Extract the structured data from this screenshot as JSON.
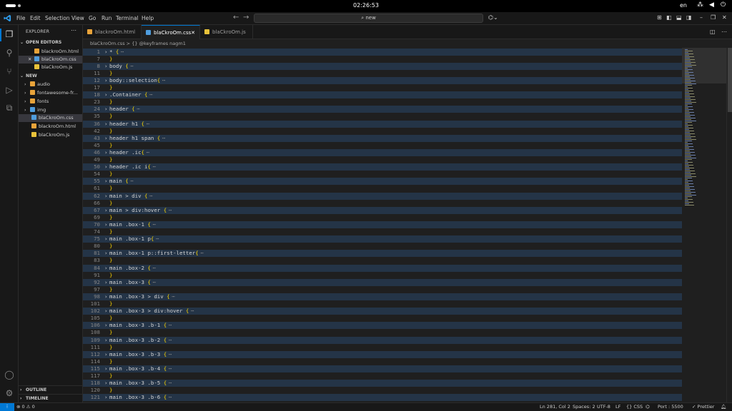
{
  "os": {
    "clock": "02:26:53",
    "lang": "en"
  },
  "menu": [
    "File",
    "Edit",
    "Selection",
    "View",
    "Go",
    "Run",
    "Terminal",
    "Help"
  ],
  "search": {
    "value": "new"
  },
  "sidebar": {
    "title": "EXPLORER",
    "open_editors_label": "OPEN EDITORS",
    "open_editors": [
      {
        "name": "blackroOm.html",
        "type": "html",
        "selected": false
      },
      {
        "name": "blaCkroOm.css",
        "type": "css",
        "selected": true
      },
      {
        "name": "blaCkroOm.js",
        "type": "js",
        "selected": false
      }
    ],
    "folder_label": "NEW",
    "tree": [
      {
        "name": "audio",
        "kind": "folder",
        "color": "#e8a33a"
      },
      {
        "name": "fontawesome-fr...",
        "kind": "folder",
        "color": "#e8a33a"
      },
      {
        "name": "fonts",
        "kind": "folder",
        "color": "#e8a33a"
      },
      {
        "name": "img",
        "kind": "folder",
        "color": "#4f9dde"
      },
      {
        "name": "blaCkroOm.css",
        "kind": "css",
        "selected": true
      },
      {
        "name": "blackroOm.html",
        "kind": "html"
      },
      {
        "name": "blaCkroOm.js",
        "kind": "js"
      }
    ],
    "outline_label": "OUTLINE",
    "timeline_label": "TIMELINE"
  },
  "tabs": [
    {
      "label": "blackroOm.html",
      "type": "html",
      "active": false
    },
    {
      "label": "blaCkroOm.css",
      "type": "css",
      "active": true
    },
    {
      "label": "blaCkroOm.js",
      "type": "js",
      "active": false
    }
  ],
  "breadcrumb": {
    "file": "blaCkroOm.css",
    "sep": ">",
    "symbol": "@keyframes nagm1"
  },
  "code_lines": [
    {
      "n": "1",
      "text": "* {",
      "fold": true
    },
    {
      "n": "7",
      "text": "}",
      "fold": false
    },
    {
      "n": "8",
      "text": "body {",
      "fold": true
    },
    {
      "n": "11",
      "text": "}",
      "fold": false
    },
    {
      "n": "12",
      "text": "body::selection{",
      "fold": true
    },
    {
      "n": "17",
      "text": "}",
      "fold": false
    },
    {
      "n": "18",
      "text": ".Container {",
      "fold": true
    },
    {
      "n": "23",
      "text": "}",
      "fold": false
    },
    {
      "n": "24",
      "text": "header {",
      "fold": true
    },
    {
      "n": "35",
      "text": "}",
      "fold": false
    },
    {
      "n": "36",
      "text": "header h1 {",
      "fold": true
    },
    {
      "n": "42",
      "text": "}",
      "fold": false
    },
    {
      "n": "43",
      "text": "header h1 span {",
      "fold": true
    },
    {
      "n": "45",
      "text": "}",
      "fold": false
    },
    {
      "n": "46",
      "text": "header .ic{",
      "fold": true
    },
    {
      "n": "49",
      "text": "}",
      "fold": false
    },
    {
      "n": "50",
      "text": "header .ic i{",
      "fold": true
    },
    {
      "n": "54",
      "text": "}",
      "fold": false
    },
    {
      "n": "55",
      "text": "main {",
      "fold": true
    },
    {
      "n": "61",
      "text": "}",
      "fold": false
    },
    {
      "n": "62",
      "text": "main > div {",
      "fold": true
    },
    {
      "n": "66",
      "text": "}",
      "fold": false
    },
    {
      "n": "67",
      "text": "main > div:hover {",
      "fold": true
    },
    {
      "n": "69",
      "text": "}",
      "fold": false
    },
    {
      "n": "70",
      "text": "main .box-1 {",
      "fold": true
    },
    {
      "n": "74",
      "text": "}",
      "fold": false
    },
    {
      "n": "75",
      "text": "main .box-1 p{",
      "fold": true
    },
    {
      "n": "80",
      "text": "}",
      "fold": false
    },
    {
      "n": "81",
      "text": "main .box-1 p::first-letter{",
      "fold": true
    },
    {
      "n": "83",
      "text": "}",
      "fold": false
    },
    {
      "n": "84",
      "text": "main .box-2 {",
      "fold": true
    },
    {
      "n": "91",
      "text": "}",
      "fold": false
    },
    {
      "n": "92",
      "text": "main .box-3 {",
      "fold": true
    },
    {
      "n": "97",
      "text": "}",
      "fold": false
    },
    {
      "n": "98",
      "text": "main .box-3 > div {",
      "fold": true
    },
    {
      "n": "101",
      "text": "}",
      "fold": false
    },
    {
      "n": "102",
      "text": "main .box-3 > div:hover {",
      "fold": true
    },
    {
      "n": "105",
      "text": "}",
      "fold": false
    },
    {
      "n": "106",
      "text": "main .box-3 .b-1 {",
      "fold": true
    },
    {
      "n": "108",
      "text": "}",
      "fold": false
    },
    {
      "n": "109",
      "text": "main .box-3 .b-2 {",
      "fold": true
    },
    {
      "n": "111",
      "text": "}",
      "fold": false
    },
    {
      "n": "112",
      "text": "main .box-3 .b-3 {",
      "fold": true
    },
    {
      "n": "114",
      "text": "}",
      "fold": false
    },
    {
      "n": "115",
      "text": "main .box-3 .b-4 {",
      "fold": true
    },
    {
      "n": "117",
      "text": "}",
      "fold": false
    },
    {
      "n": "118",
      "text": "main .box-3 .b-5 {",
      "fold": true
    },
    {
      "n": "120",
      "text": "}",
      "fold": false
    },
    {
      "n": "121",
      "text": "main .box-3 .b-6 {",
      "fold": true
    }
  ],
  "status": {
    "problems": "⊗ 0 ⚠ 0",
    "position": "Ln 281, Col 2",
    "spaces": "Spaces: 2",
    "encoding": "UTF-8",
    "eol": "LF",
    "language": "{} CSS",
    "port": "Port : 5500",
    "prettier": "✓ Prettier"
  },
  "colors": {
    "accent": "#0078d4",
    "brace": "#ffd700",
    "fold_bg": "#243447",
    "css_icon": "#4f9dde",
    "html_icon": "#e8a33a",
    "js_icon": "#e8c23a"
  }
}
